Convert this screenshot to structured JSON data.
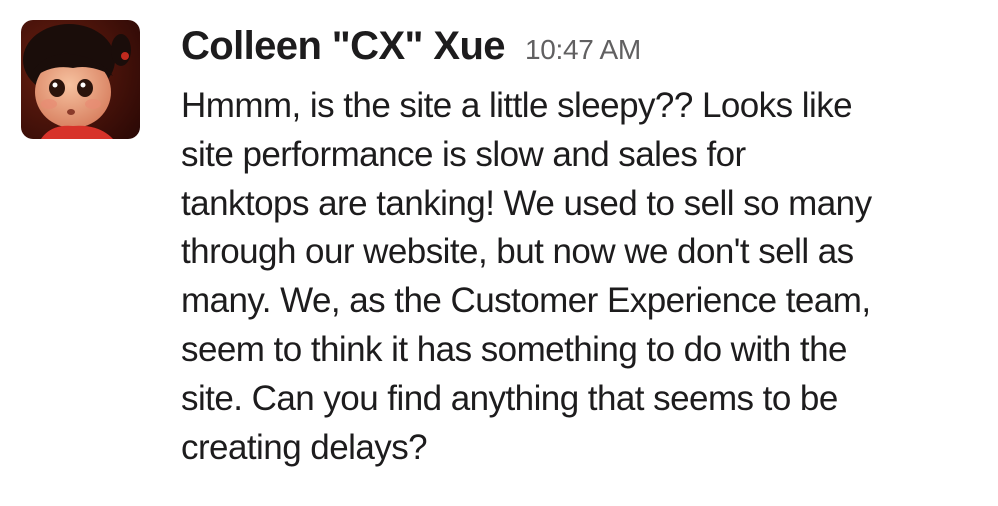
{
  "message": {
    "author": "Colleen \"CX\" Xue",
    "timestamp": "10:47 AM",
    "avatar_icon": "user-avatar-cartoon-girl",
    "lines": [
      "Hmmm, is the site a little sleepy?? Looks like",
      "site performance is slow and sales for",
      "tanktops are tanking! We used to sell so many",
      "through our website, but now we don't sell as",
      "many. We, as the Customer Experience team,",
      "seem to think it has something to do with the",
      "site. Can you find anything that seems to be",
      "creating delays?"
    ]
  },
  "colors": {
    "text": "#1d1c1d",
    "timestamp": "#616061",
    "background": "#ffffff"
  }
}
